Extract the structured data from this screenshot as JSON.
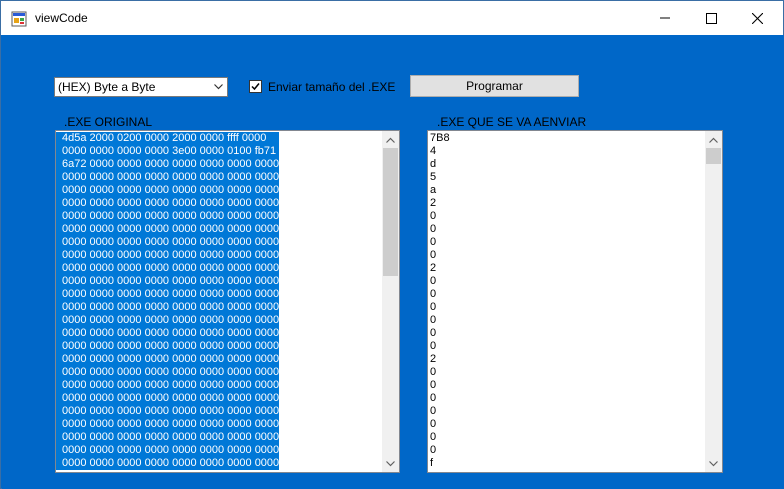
{
  "window": {
    "title": "viewCode"
  },
  "controls": {
    "mode_select": "(HEX) Byte a Byte",
    "send_size_label": "Enviar tamaño del .EXE",
    "send_size_checked": true,
    "program_button": "Programar"
  },
  "original": {
    "label": ".EXE ORIGINAL",
    "lines": [
      "4d5a 2000 0200 0000 2000 0000 ffff 0000",
      "0000 0000 0000 0000 3e00 0000 0100 fb71",
      "6a72 0000 0000 0000 0000 0000 0000 0000",
      "0000 0000 0000 0000 0000 0000 0000 0000",
      "0000 0000 0000 0000 0000 0000 0000 0000",
      "0000 0000 0000 0000 0000 0000 0000 0000",
      "0000 0000 0000 0000 0000 0000 0000 0000",
      "0000 0000 0000 0000 0000 0000 0000 0000",
      "0000 0000 0000 0000 0000 0000 0000 0000",
      "0000 0000 0000 0000 0000 0000 0000 0000",
      "0000 0000 0000 0000 0000 0000 0000 0000",
      "0000 0000 0000 0000 0000 0000 0000 0000",
      "0000 0000 0000 0000 0000 0000 0000 0000",
      "0000 0000 0000 0000 0000 0000 0000 0000",
      "0000 0000 0000 0000 0000 0000 0000 0000",
      "0000 0000 0000 0000 0000 0000 0000 0000",
      "0000 0000 0000 0000 0000 0000 0000 0000",
      "0000 0000 0000 0000 0000 0000 0000 0000",
      "0000 0000 0000 0000 0000 0000 0000 0000",
      "0000 0000 0000 0000 0000 0000 0000 0000",
      "0000 0000 0000 0000 0000 0000 0000 0000",
      "0000 0000 0000 0000 0000 0000 0000 0000",
      "0000 0000 0000 0000 0000 0000 0000 0000",
      "0000 0000 0000 0000 0000 0000 0000 0000",
      "0000 0000 0000 0000 0000 0000 0000 0000",
      "0000 0000 0000 0000 0000 0000 0000 0000"
    ]
  },
  "to_send": {
    "label": ".EXE QUE SE VA AENVIAR",
    "lines": [
      "7B8",
      "4",
      "d",
      "5",
      "a",
      "2",
      "0",
      "0",
      "0",
      "0",
      "2",
      "0",
      "0",
      "0",
      "0",
      "0",
      "0",
      "2",
      "0",
      "0",
      "0",
      "0",
      "0",
      "0",
      "0",
      "f"
    ]
  }
}
